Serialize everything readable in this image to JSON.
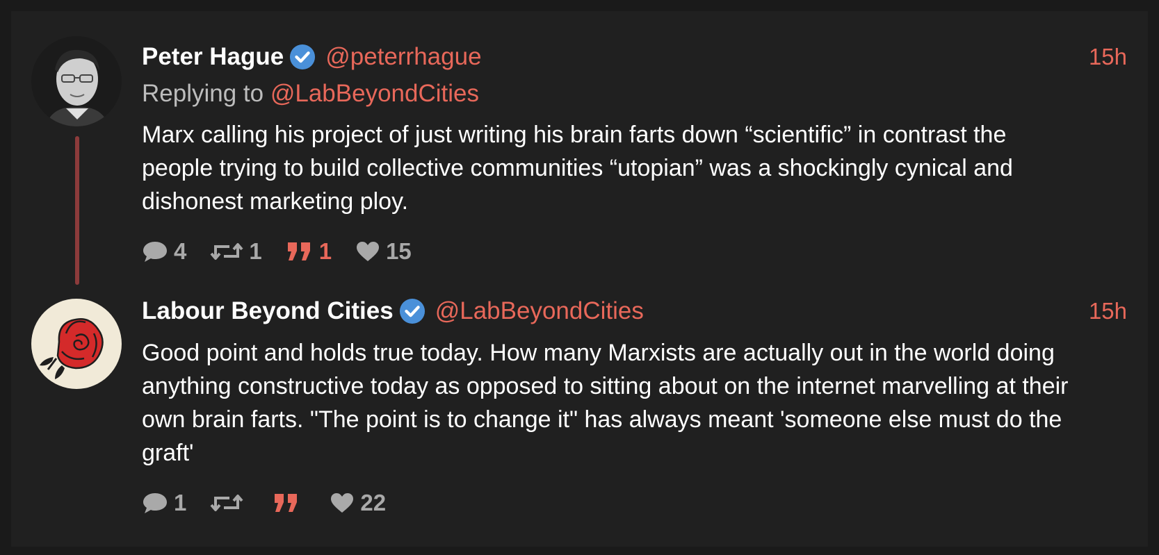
{
  "tweets": [
    {
      "author_name": "Peter Hague",
      "handle": "@peterrhague",
      "time": "15h",
      "replying_prefix": "Replying to",
      "replying_handle": "@LabBeyondCities",
      "text": "Marx calling his project of just writing his brain farts down “scientific” in contrast the people trying to build collective communities “utopian” was a shockingly cynical and dishonest marketing ploy.",
      "replies": "4",
      "retweets": "1",
      "quotes": "1",
      "likes": "15"
    },
    {
      "author_name": "Labour Beyond Cities",
      "handle": "@LabBeyondCities",
      "time": "15h",
      "text": "Good point and holds true today. How many Marxists are actually out in the world doing anything constructive today as opposed to sitting about on the internet marvelling at their own brain farts. \"The point is to change it\" has always meant 'someone else must do the graft'",
      "replies": "1",
      "retweets": "",
      "quotes": "",
      "likes": "22"
    }
  ],
  "colors": {
    "background": "#1a1a1a",
    "panel": "#202020",
    "accent": "#e8685a",
    "verified": "#4a90d9",
    "thread_line": "#8c3b3b",
    "muted": "#a9a9a9"
  },
  "icons": {
    "reply": "speech-bubble-icon",
    "retweet": "retweet-icon",
    "quote": "quote-icon",
    "like": "heart-icon",
    "verified": "verified-badge-icon"
  }
}
